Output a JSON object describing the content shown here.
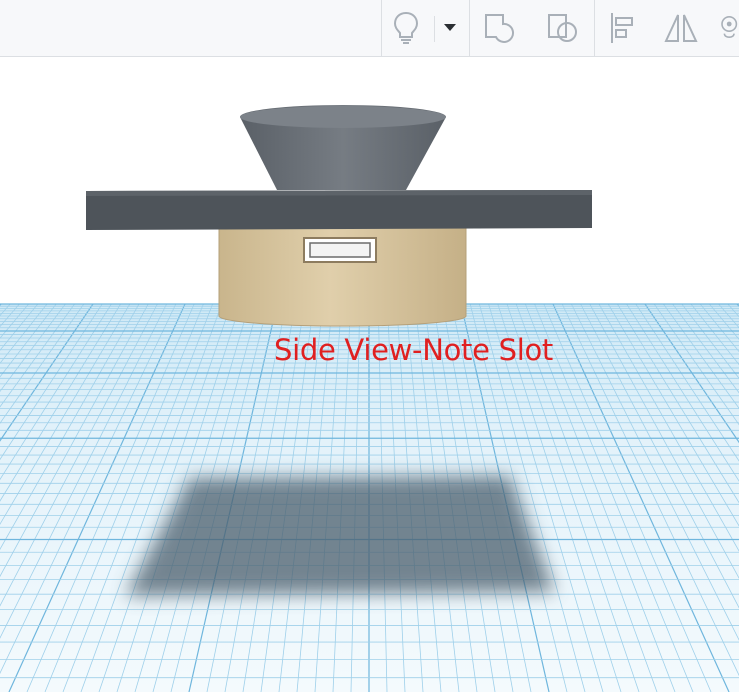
{
  "toolbar": {
    "buttons": [
      {
        "icon": "lightbulb-icon",
        "label": ""
      },
      {
        "icon": "dropdown-caret-icon",
        "label": ""
      },
      {
        "icon": "group-icon",
        "label": ""
      },
      {
        "icon": "ungroup-icon",
        "label": ""
      },
      {
        "icon": "align-icon",
        "label": ""
      },
      {
        "icon": "mirror-icon",
        "label": ""
      },
      {
        "icon": "cruise-icon",
        "label": ""
      }
    ]
  },
  "scene": {
    "annotation": "Side View-Note Slot",
    "colors": {
      "grid_background": "#d9eef8",
      "grid_line": "#8fc7e6",
      "cone": "#6a7077",
      "plate": "#555b61",
      "cylinder": "#d8c49c",
      "annotation": "#e02020"
    }
  }
}
